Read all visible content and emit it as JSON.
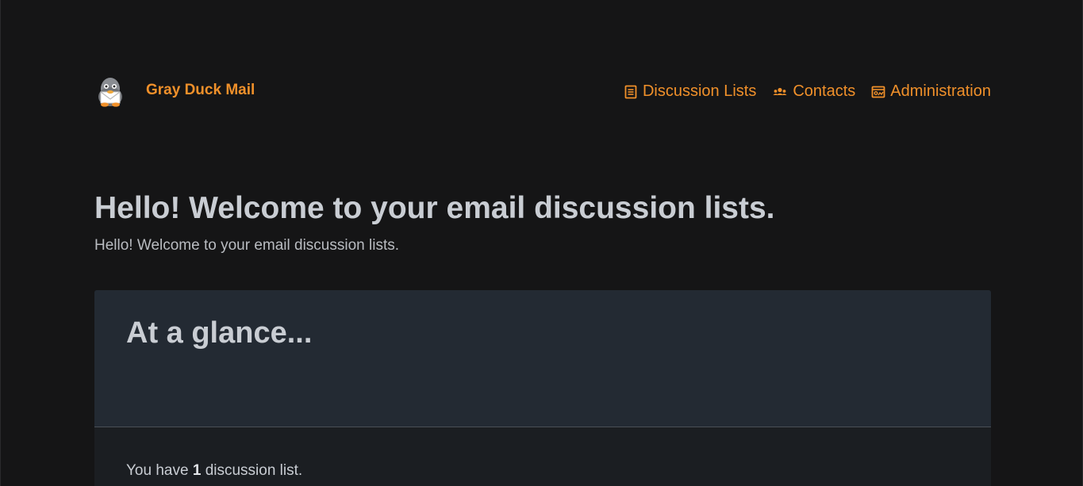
{
  "brand": {
    "name": "Gray Duck Mail",
    "logo_icon": "duck-mascot-icon"
  },
  "nav": {
    "items": [
      {
        "label": "Discussion Lists",
        "icon": "list-icon"
      },
      {
        "label": "Contacts",
        "icon": "people-icon"
      },
      {
        "label": "Administration",
        "icon": "admin-panel-icon"
      }
    ]
  },
  "hero": {
    "title": "Hello! Welcome to your email discussion lists.",
    "subtitle": "Hello! Welcome to your email discussion lists."
  },
  "glance": {
    "title": "At a glance...",
    "summary_prefix": "You have",
    "list_count": "1",
    "summary_suffix": "discussion list."
  },
  "colors": {
    "background": "#151516",
    "accent": "#f0902a",
    "card_header": "#232a33",
    "card_body": "#1b1e22",
    "text": "#c9cdd3"
  }
}
